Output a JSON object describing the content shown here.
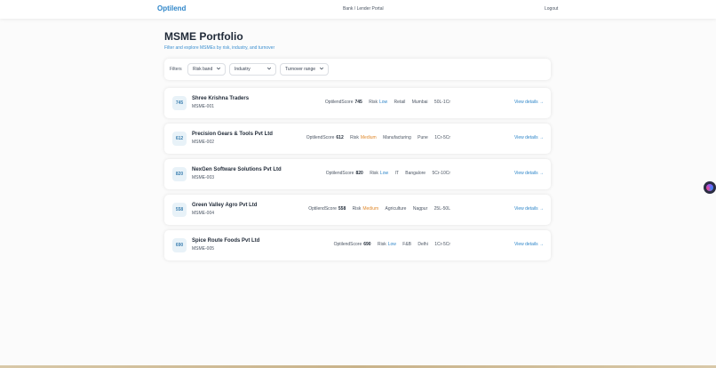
{
  "header": {
    "brand": "Optilend",
    "portal": "Bank / Lender Portal",
    "logout": "Logout"
  },
  "page": {
    "title": "MSME Portfolio",
    "subtitle": "Filter and explore MSMEs by risk, industry, and turnover"
  },
  "filters": {
    "label": "Filters",
    "selects": [
      {
        "label": "Risk band",
        "icon": "chevron-down-icon"
      },
      {
        "label": "Industry",
        "icon": "chevron-down-icon"
      },
      {
        "label": "Turnover range",
        "icon": "chevron-down-icon"
      }
    ]
  },
  "msmes": [
    {
      "score": "745",
      "name": "Shree Krishna Traders",
      "code": "MSME-001",
      "score_label": "OptilendScore",
      "risk_label": "Risk",
      "risk": "Low",
      "industry": "Retail",
      "city": "Mumbai",
      "turnover": "50L-1Cr",
      "action": "View details →"
    },
    {
      "score": "612",
      "name": "Precision Gears & Tools Pvt Ltd",
      "code": "MSME-002",
      "score_label": "OptilendScore",
      "risk_label": "Risk",
      "risk": "Medium",
      "industry": "Manufacturing",
      "city": "Pune",
      "turnover": "1Cr-5Cr",
      "action": "View details →"
    },
    {
      "score": "820",
      "name": "NexGen Software Solutions Pvt Ltd",
      "code": "MSME-003",
      "score_label": "OptilendScore",
      "risk_label": "Risk",
      "risk": "Low",
      "industry": "IT",
      "city": "Bangalore",
      "turnover": "5Cr-10Cr",
      "action": "View details →"
    },
    {
      "score": "558",
      "name": "Green Valley Agro Pvt Ltd",
      "code": "MSME-004",
      "score_label": "OptilendScore",
      "risk_label": "Risk",
      "risk": "Medium",
      "industry": "Agriculture",
      "city": "Nagpur",
      "turnover": "25L-50L",
      "action": "View details →"
    },
    {
      "score": "690",
      "name": "Spice Route Foods Pvt Ltd",
      "code": "MSME-005",
      "score_label": "OptilendScore",
      "risk_label": "Risk",
      "risk": "Low",
      "industry": "F&B",
      "city": "Delhi",
      "turnover": "1Cr-5Cr",
      "action": "View details →"
    }
  ],
  "colors": {
    "brand": "#2f86c9",
    "risk_low": "#2f86c9",
    "risk_medium": "#e08a2e"
  }
}
